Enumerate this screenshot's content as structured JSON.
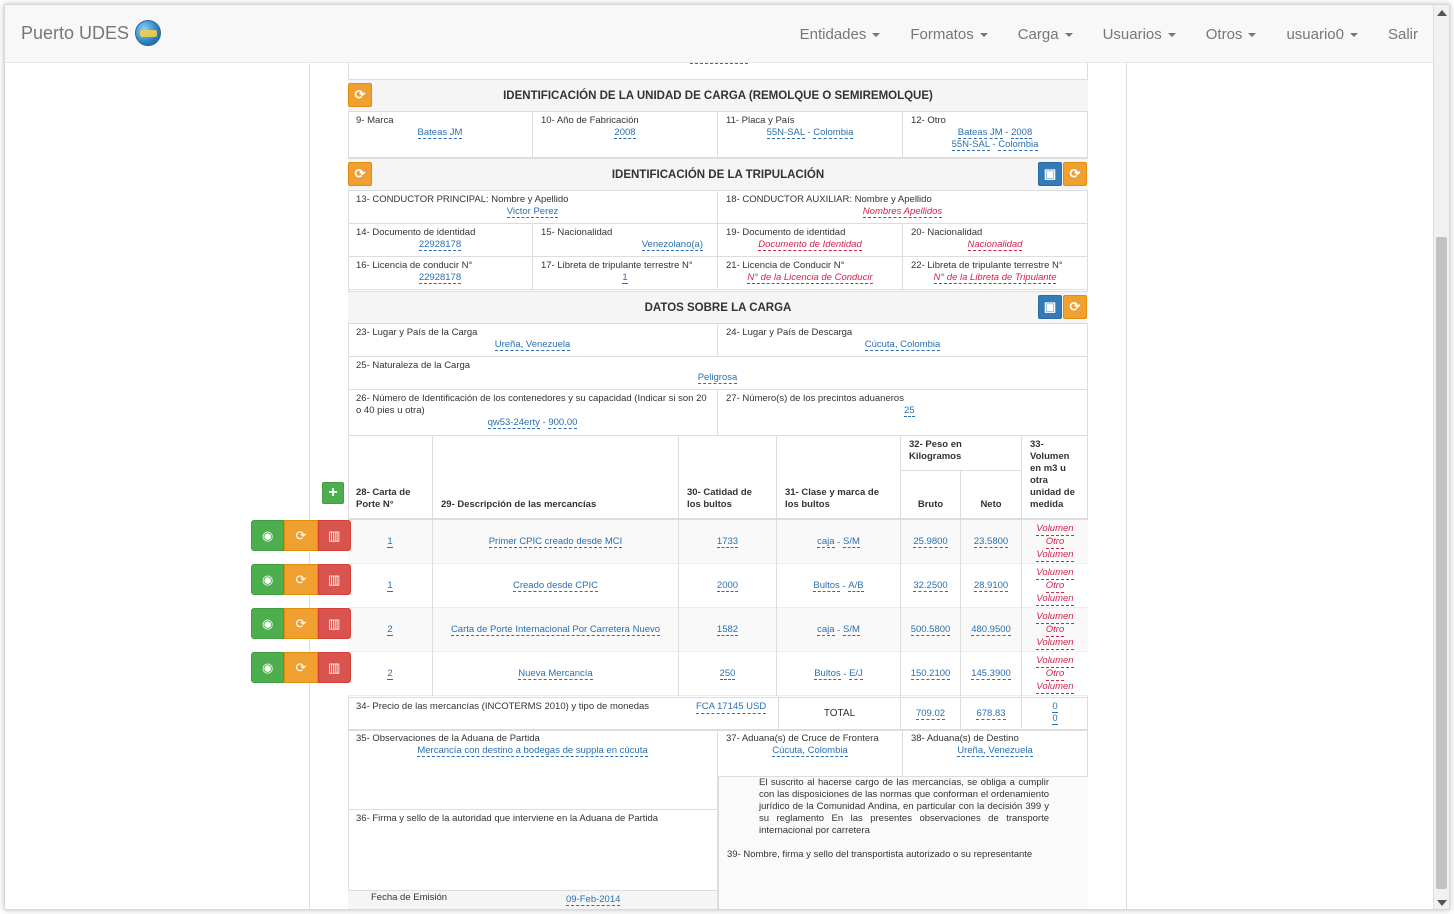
{
  "navbar": {
    "brand": "Puerto UDES",
    "menu": [
      "Entidades",
      "Formatos",
      "Carga",
      "Usuarios",
      "Otros",
      "usuario0",
      "Salir"
    ]
  },
  "unidad": {
    "title": "IDENTIFICACIÓN DE LA UNIDAD DE CARGA (REMOLQUE O SEMIREMOLQUE)",
    "marca_label": "9- Marca",
    "marca": "Bateas JM",
    "anio_label": "10- Año de Fabricación",
    "anio": "2008",
    "placa_label": "11- Placa y País",
    "placa": "55N-SAL",
    "pais": "Colombia",
    "otro_label": "12- Otro",
    "otro1a": "Bateas JM",
    "otro1b": "2008",
    "otro2a": "55N-SAL",
    "otro2b": "Colombia"
  },
  "tripulacion": {
    "title": "IDENTIFICACIÓN DE LA TRIPULACIÓN",
    "c13_label": "13- CONDUCTOR PRINCIPAL: Nombre y Apellido",
    "c13": "Victor Perez",
    "c18_label": "18- CONDUCTOR AUXILIAR: Nombre y Apellido",
    "c18": "Nombres Apellidos",
    "c14_label": "14- Documento de identidad",
    "c14": "22928178",
    "c15_label": "15- Nacionalidad",
    "c15": "Venezolano(a)",
    "c19_label": "19- Documento de identidad",
    "c19": "Documento de Identidad",
    "c20_label": "20- Nacionalidad",
    "c20": "Nacionalidad",
    "c16_label": "16- Licencia de conducir N°",
    "c16": "22928178",
    "c17_label": "17- Libreta de tripulante terrestre N°",
    "c17": "1",
    "c21_label": "21- Licencia de Conducir N°",
    "c21": "N° de la Licencia de Conducir",
    "c22_label": "22- Libreta de tripulante terrestre N°",
    "c22": "N° de la Libreta de Tripulante"
  },
  "carga": {
    "title": "DATOS SOBRE LA CARGA",
    "c23_label": "23- Lugar y País de la Carga",
    "c23": "Ureña, Venezuela",
    "c24_label": "24- Lugar y País de Descarga",
    "c24": "Cúcuta, Colombia",
    "c25_label": "25- Naturaleza de la Carga",
    "c25": "Peligrosa",
    "c26_label": "26- Número de Identificación de los contenedores y su capacidad (Indicar si son 20 o 40 pies u otra)",
    "c26a": "qw53-24erty",
    "c26b": "900.00",
    "c27_label": "27- Número(s) de los precintos aduaneros",
    "c27": "25"
  },
  "table": {
    "h28": "28- Carta de Porte N°",
    "h29": "29- Descripción de las mercancías",
    "h30": "30- Catidad de los bultos",
    "h31": "31- Clase y marca de los bultos",
    "h32": "32- Peso en Kilogramos",
    "h32b": "Bruto",
    "h32n": "Neto",
    "h33": "33- Volumen en m3 u otra unidad de medida",
    "vol_a": "Volumen",
    "vol_b": "Otro",
    "vol_c": "Volumen",
    "rows": [
      {
        "carta": "1",
        "desc": "Primer CPIC creado desde MCI",
        "cant": "1733",
        "clase": "caja",
        "marca": "S/M",
        "bruto": "25.9800",
        "neto": "23.5800"
      },
      {
        "carta": "1",
        "desc": "Creado desde CPIC",
        "cant": "2000",
        "clase": "Bultos",
        "marca": "A/B",
        "bruto": "32.2500",
        "neto": "28.9100"
      },
      {
        "carta": "2",
        "desc": "Carta de Porte Internacional Por Carretera Nuevo",
        "cant": "1582",
        "clase": "caja",
        "marca": "S/M",
        "bruto": "500.5800",
        "neto": "480.9500"
      },
      {
        "carta": "2",
        "desc": "Nueva Mercancía",
        "cant": "250",
        "clase": "Bultos",
        "marca": "E/J",
        "bruto": "150.2100",
        "neto": "145.3900"
      }
    ],
    "c34_label": "34- Precio de las mercancías (INCOTERMS 2010) y tipo de monedas",
    "c34": "FCA 17145 USD",
    "total_label": "TOTAL",
    "total_bruto": "709.02",
    "total_neto": "678.83",
    "total_vol1": "0",
    "total_vol2": "0"
  },
  "aduanas": {
    "c35_label": "35- Observaciones de la Aduana de Partida",
    "c35": "Mercancía con destino a bodegas de suppla en cúcuta",
    "c37_label": "37- Aduana(s) de Cruce de Frontera",
    "c37": "Cúcuta, Colombia",
    "c38_label": "38- Aduana(s) de Destino",
    "c38": "Ureña, Venezuela",
    "decl": "El suscrito al hacerse cargo de las mercancías, se obliga a cumplir con las disposiciones de las normas que conforman el ordenamiento jurídico de la Comunidad Andina, en particular con la decisión 399 y su reglamento En las presentes observaciones de transporte internacional por carretera",
    "c36_label": "36- Firma y sello de la autoridad que interviene en la Aduana de Partida",
    "c39_label": "39- Nombre, firma y sello del transportista autorizado o su representante",
    "fecha_label": "Fecha de Emisión",
    "fecha": "09-Feb-2014"
  }
}
